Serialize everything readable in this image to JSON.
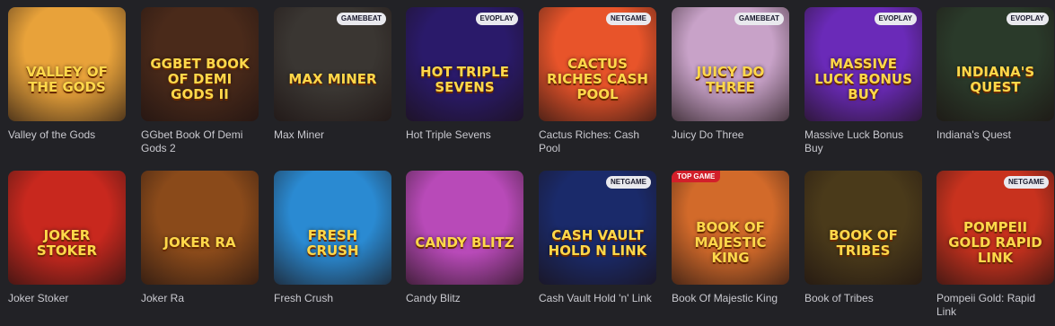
{
  "games": [
    {
      "name": "Valley of the Gods",
      "art_title": "Valley of the Gods",
      "badge": "",
      "bg": "#e8a23a"
    },
    {
      "name": "GGbet Book Of Demi Gods 2",
      "art_title": "GGbet Book of Demi Gods II",
      "badge": "",
      "bg": "#4a2a1a"
    },
    {
      "name": "Max Miner",
      "art_title": "Max Miner",
      "badge": "GAMEBEAT",
      "bg": "#3a3632"
    },
    {
      "name": "Hot Triple Sevens",
      "art_title": "Hot Triple Sevens",
      "badge": "EVOPLAY",
      "bg": "#2a1a6a"
    },
    {
      "name": "Cactus Riches: Cash Pool",
      "art_title": "Cactus Riches Cash Pool",
      "badge": "NETGAME",
      "bg": "#e8542a"
    },
    {
      "name": "Juicy Do Three",
      "art_title": "Juicy Do Three",
      "badge": "GAMEBEAT",
      "bg": "#c8a2c8"
    },
    {
      "name": "Massive Luck Bonus Buy",
      "art_title": "Massive Luck Bonus Buy",
      "badge": "EVOPLAY",
      "bg": "#6a2ab8"
    },
    {
      "name": "Indiana's Quest",
      "art_title": "Indiana's Quest",
      "badge": "EVOPLAY",
      "bg": "#2a3a2a"
    },
    {
      "name": "Joker Stoker",
      "art_title": "Joker Stoker",
      "badge": "",
      "bg": "#c8281e"
    },
    {
      "name": "Joker Ra",
      "art_title": "Joker Ra",
      "badge": "",
      "bg": "#8a4a1a"
    },
    {
      "name": "Fresh Crush",
      "art_title": "Fresh Crush",
      "badge": "",
      "bg": "#2a8ad2"
    },
    {
      "name": "Candy Blitz",
      "art_title": "Candy Blitz",
      "badge": "",
      "bg": "#b84ab8"
    },
    {
      "name": "Cash Vault Hold 'n' Link",
      "art_title": "Cash Vault Hold n Link",
      "badge": "NETGAME",
      "bg": "#1a2a6a"
    },
    {
      "name": "Book Of Majestic King",
      "art_title": "Book of Majestic King",
      "badge": "",
      "corner": "TOP GAME",
      "bg": "#d26a2a"
    },
    {
      "name": "Book of Tribes",
      "art_title": "Book of Tribes",
      "badge": "",
      "bg": "#4a3a1a"
    },
    {
      "name": "Pompeii Gold: Rapid Link",
      "art_title": "Pompeii Gold Rapid Link",
      "badge": "NETGAME",
      "bg": "#c8321e"
    }
  ]
}
